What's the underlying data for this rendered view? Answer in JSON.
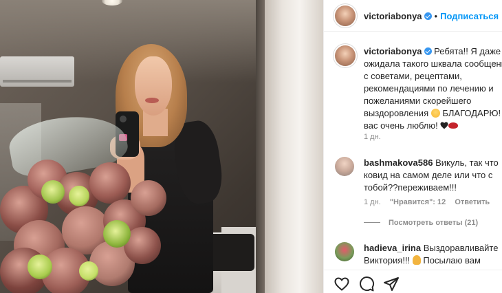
{
  "post": {
    "author": "victoriabonya",
    "follow_label": "Подписаться",
    "separator": "•"
  },
  "caption": {
    "username": "victoriabonya",
    "line1": "Ребята!! Я даже не",
    "line2": "ожидала такого шквала сообщений",
    "line3": "с советами, рецептами,",
    "line4": "рекомендациями по лечению и",
    "line5": "пожеланиями скорейшего",
    "line6": "выздоровления",
    "line6b": "БЛАГОДАРЮ!",
    "line7": "вас очень люблю!",
    "age": "1 дн."
  },
  "comments": [
    {
      "username": "bashmakova586",
      "text_line1": "Викуль, так что",
      "text_line2": "ковид на самом деле или что с",
      "text_line3": "тобой??переживаем!!!",
      "age": "1 дн.",
      "likes": "\"Нравится\": 12",
      "reply": "Ответить",
      "view_replies": "Посмотреть ответы (21)"
    },
    {
      "username": "hadieva_irina",
      "text_line1": "Выздоравливайте",
      "text_line2": "Виктория!!!",
      "text_line3": "Посылаю вам"
    }
  ],
  "icons": {
    "like": "heart-outline-icon",
    "comment": "comment-bubble-icon",
    "share": "paper-plane-icon",
    "verified": "verified-badge-icon"
  },
  "colors": {
    "accent": "#0095f6",
    "verified": "#3897f0",
    "muted": "#8e8e8e",
    "text": "#262626"
  }
}
